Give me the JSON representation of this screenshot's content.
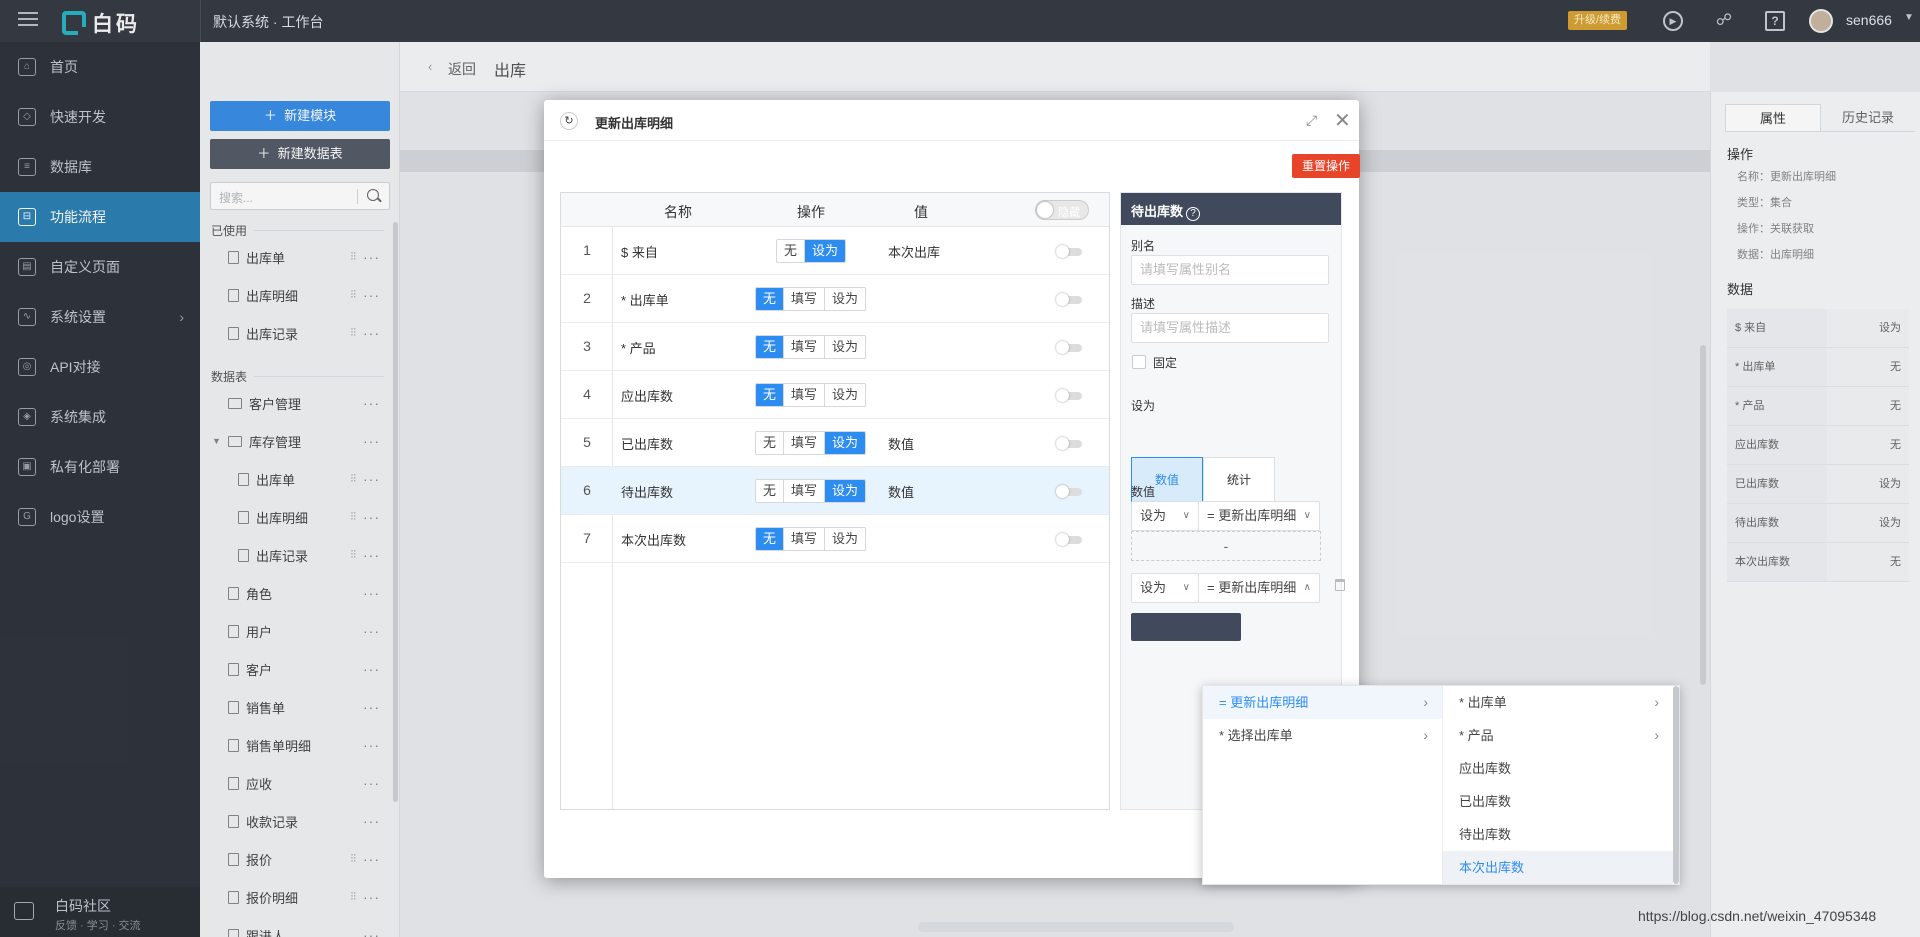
{
  "topbar": {
    "brand": "白码",
    "crumb": "默认系统 · 工作台",
    "upgrade_badge": "升级/续费",
    "username": "sen666"
  },
  "sidebar": {
    "items": [
      {
        "label": "首页",
        "icon": "home-icon"
      },
      {
        "label": "快速开发",
        "icon": "cube-icon"
      },
      {
        "label": "数据库",
        "icon": "database-icon"
      },
      {
        "label": "功能流程",
        "icon": "flow-icon",
        "active": true
      },
      {
        "label": "自定义页面",
        "icon": "page-icon"
      },
      {
        "label": "系统设置",
        "icon": "settings-icon"
      },
      {
        "label": "API对接",
        "icon": "api-icon"
      },
      {
        "label": "系统集成",
        "icon": "layers-icon"
      },
      {
        "label": "私有化部署",
        "icon": "lock-icon"
      },
      {
        "label": "logo设置",
        "icon": "logo-icon"
      }
    ],
    "community_title": "白码社区",
    "community_sub": "反馈 · 学习 · 交流"
  },
  "modlist": {
    "new_module": "新建模块",
    "new_table": "新建数据表",
    "search_placeholder": "搜索...",
    "group_used": "已使用",
    "group_tables": "数据表",
    "used_items": [
      "出库单",
      "出库明细",
      "出库记录"
    ],
    "table_items": [
      "客户管理",
      "库存管理",
      "出库单",
      "出库明细",
      "出库记录",
      "角色",
      "用户",
      "客户",
      "销售单",
      "销售单明细",
      "应收",
      "收款记录",
      "报价",
      "报价明细",
      "跟进人"
    ]
  },
  "main": {
    "back": "返回",
    "title": "出库"
  },
  "right_panel": {
    "tabs": [
      "属性",
      "历史记录"
    ],
    "section_op": "操作",
    "props": [
      "名称：更新出库明细",
      "类型：集合",
      "操作：关联获取",
      "数据：出库明细"
    ],
    "section_data": "数据",
    "rows": [
      {
        "k": "$ 来自",
        "v": "设为"
      },
      {
        "k": "* 出库单",
        "v": "无"
      },
      {
        "k": "* 产品",
        "v": "无"
      },
      {
        "k": "应出库数",
        "v": "无"
      },
      {
        "k": "已出库数",
        "v": "设为"
      },
      {
        "k": "待出库数",
        "v": "设为"
      },
      {
        "k": "本次出库数",
        "v": "无"
      }
    ]
  },
  "dialog": {
    "title": "更新出库明细",
    "reset_btn": "重置操作",
    "headers": {
      "name": "名称",
      "op": "操作",
      "value": "值",
      "hide_toggle": "隐藏"
    },
    "rows": [
      {
        "idx": "1",
        "name": "$ 来自",
        "ops": [
          "无",
          "设为"
        ],
        "on": 1,
        "value": "本次出库"
      },
      {
        "idx": "2",
        "name": "* 出库单",
        "ops": [
          "无",
          "填写",
          "设为"
        ],
        "on": 0,
        "value": ""
      },
      {
        "idx": "3",
        "name": "* 产品",
        "ops": [
          "无",
          "填写",
          "设为"
        ],
        "on": 0,
        "value": ""
      },
      {
        "idx": "4",
        "name": "应出库数",
        "ops": [
          "无",
          "填写",
          "设为"
        ],
        "on": 0,
        "value": ""
      },
      {
        "idx": "5",
        "name": "已出库数",
        "ops": [
          "无",
          "填写",
          "设为"
        ],
        "on": 2,
        "value": "数值"
      },
      {
        "idx": "6",
        "name": "待出库数",
        "ops": [
          "无",
          "填写",
          "设为"
        ],
        "on": 2,
        "value": "数值"
      },
      {
        "idx": "7",
        "name": "本次出库数",
        "ops": [
          "无",
          "填写",
          "设为"
        ],
        "on": 0,
        "value": ""
      }
    ],
    "pane": {
      "title": "待出库数",
      "alias_label": "别名",
      "alias_placeholder": "请填写属性别名",
      "desc_label": "描述",
      "desc_placeholder": "请填写属性描述",
      "fixed_label": "固定",
      "set_label": "设为",
      "tile_value": "数值",
      "tile_stat": "统计",
      "value_label": "数值",
      "sel1_mode": "设为",
      "sel1_target": "= 更新出库明细",
      "minus": "-",
      "sel2_mode": "设为",
      "sel2_target": "= 更新出库明细"
    }
  },
  "cascader": {
    "col1": [
      "= 更新出库明细",
      "* 选择出库单"
    ],
    "col2": [
      "* 出库单",
      "* 产品",
      "应出库数",
      "已出库数",
      "待出库数",
      "本次出库数"
    ]
  },
  "watermark": "https://blog.csdn.net/weixin_47095348"
}
